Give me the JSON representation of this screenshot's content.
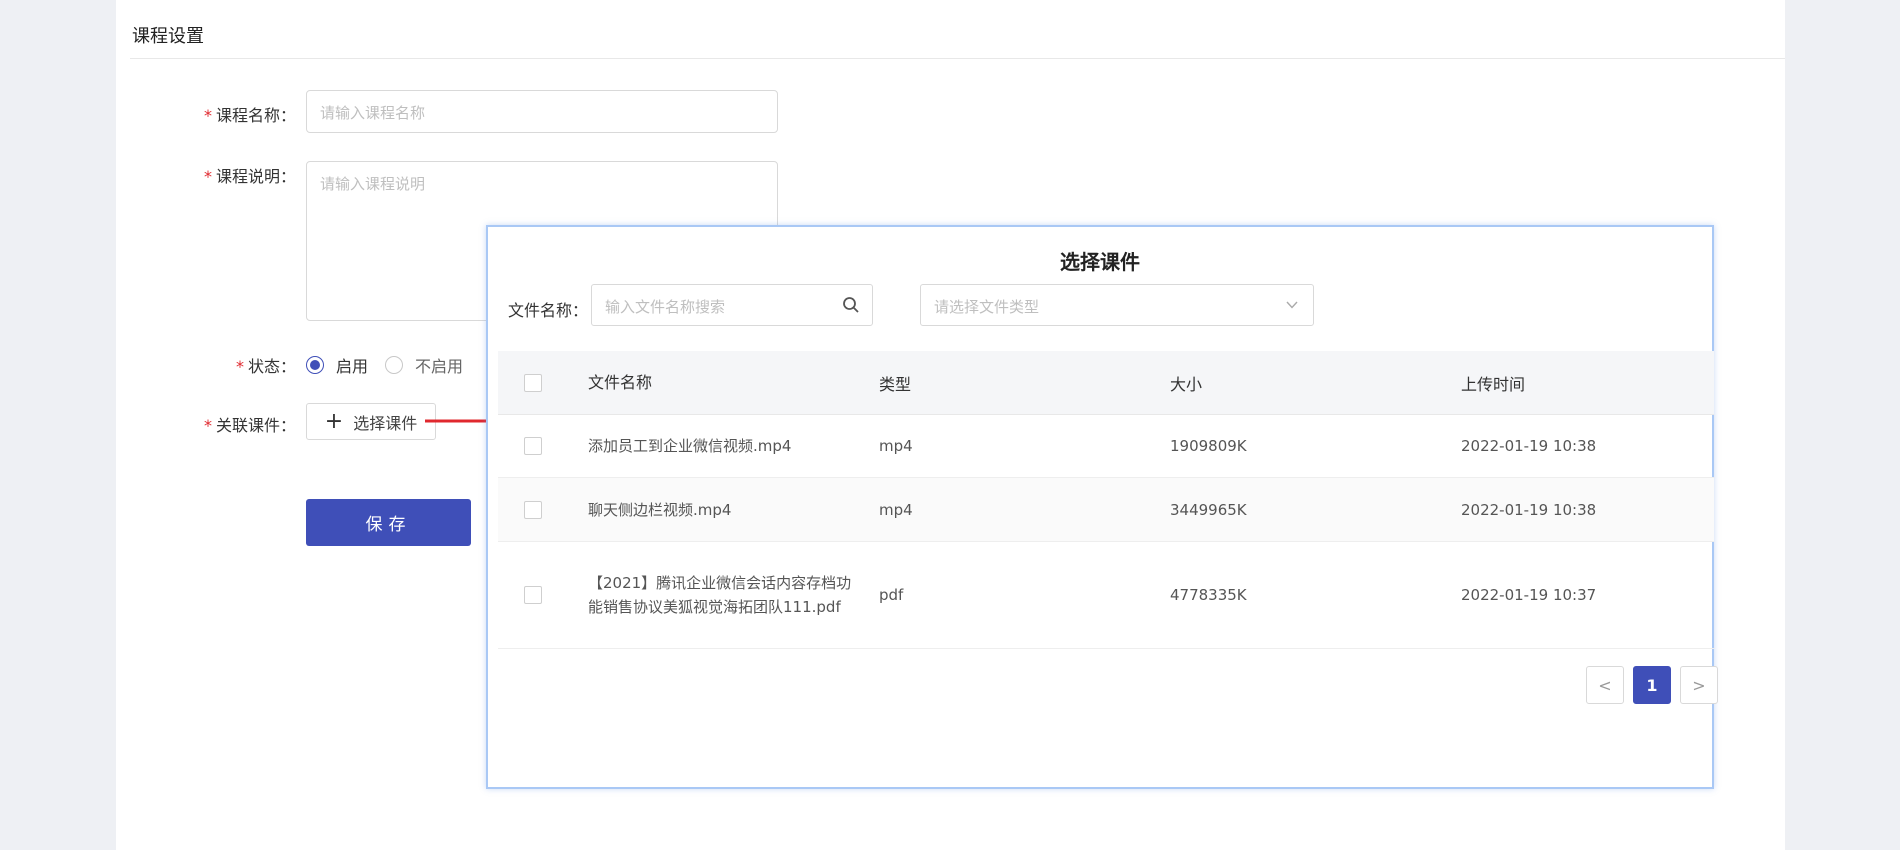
{
  "page": {
    "title": "课程设置"
  },
  "form": {
    "name_label": "课程名称：",
    "name_placeholder": "请输入课程名称",
    "desc_label": "课程说明：",
    "desc_placeholder": "请输入课程说明",
    "status_label": "状态：",
    "status_options": [
      "启用",
      "不启用"
    ],
    "status_selected": "启用",
    "courseware_label": "关联课件：",
    "choose_button": "选择课件",
    "save_button": "保存",
    "required_mark": "*"
  },
  "modal": {
    "title": "选择课件",
    "filter_label": "文件名称：",
    "search_placeholder": "输入文件名称搜索",
    "type_placeholder": "请选择文件类型",
    "columns": [
      "文件名称",
      "类型",
      "大小",
      "上传时间"
    ],
    "rows": [
      {
        "name": "添加员工到企业微信视频.mp4",
        "type": "mp4",
        "size": "1909809K",
        "time": "2022-01-19 10:38"
      },
      {
        "name": "聊天侧边栏视频.mp4",
        "type": "mp4",
        "size": "3449965K",
        "time": "2022-01-19 10:38"
      },
      {
        "name": "【2021】腾讯企业微信会话内容存档功能销售协议美狐视觉海拓团队111.pdf",
        "type": "pdf",
        "size": "4778335K",
        "time": "2022-01-19 10:37"
      }
    ],
    "pagination": {
      "prev": "<",
      "current": "1",
      "next": ">"
    }
  },
  "colors": {
    "accent": "#3f4fb8",
    "required": "#e0282e",
    "arrow": "#e0282e",
    "modal_border": "#a9c8f5"
  },
  "icons": {
    "search": "search-icon",
    "dropdown": "chevron-down-icon",
    "plus": "plus-icon",
    "arrow": "arrow-right-annotation"
  }
}
